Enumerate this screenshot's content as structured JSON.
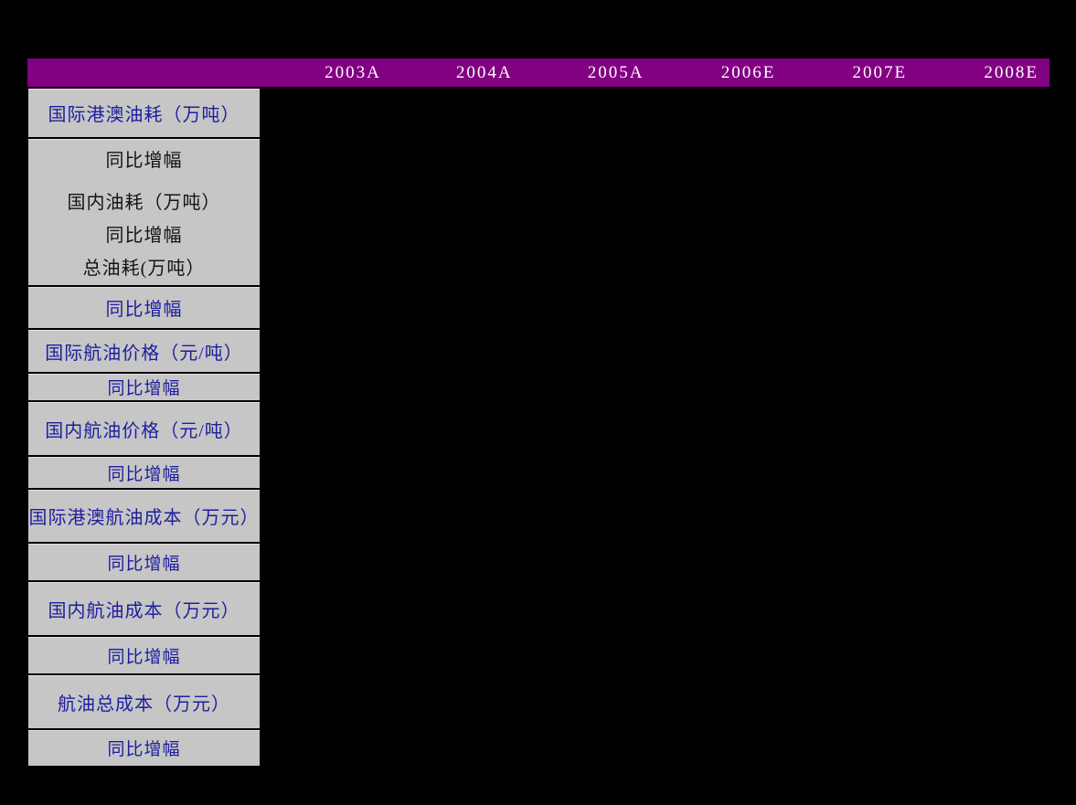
{
  "colors": {
    "page_bg": "#000000",
    "header_bg": "#820082",
    "header_text": "#FFFFFF",
    "cell_bg": "#C6C6C6",
    "label_blue": "#1E1E9E",
    "label_black": "#141414",
    "border": "#000000"
  },
  "table": {
    "year_columns": [
      "2003A",
      "2004A",
      "2005A",
      "2006E",
      "2007E",
      "2008E"
    ],
    "rows": [
      {
        "label": "国际港澳油耗（万吨）"
      },
      {
        "lines": [
          "同比增幅",
          "国内油耗（万吨）",
          "同比增幅",
          "总油耗(万吨）"
        ]
      },
      {
        "label": "同比增幅"
      },
      {
        "label": "国际航油价格（元/吨）"
      },
      {
        "label": "同比增幅"
      },
      {
        "label": "国内航油价格（元/吨）"
      },
      {
        "label": "同比增幅"
      },
      {
        "label": "国际港澳航油成本（万元）"
      },
      {
        "label": "同比增幅"
      },
      {
        "label": "国内航油成本（万元）"
      },
      {
        "label": "同比增幅"
      },
      {
        "label": "航油总成本（万元）"
      },
      {
        "label": "同比增幅"
      }
    ]
  },
  "chart_data": {
    "type": "table",
    "columns": [
      "",
      "2003A",
      "2004A",
      "2005A",
      "2006E",
      "2007E",
      "2008E"
    ],
    "row_labels": [
      "国际港澳油耗（万吨）",
      "同比增幅",
      "国内油耗（万吨）",
      "同比增幅",
      "总油耗(万吨）",
      "同比增幅",
      "国际航油价格（元/吨）",
      "同比增幅",
      "国内航油价格（元/吨）",
      "同比增幅",
      "国际港澳航油成本（万元）",
      "同比增幅",
      "国内航油成本（万元）",
      "同比增幅",
      "航油总成本（万元）",
      "同比增幅"
    ],
    "values": []
  }
}
